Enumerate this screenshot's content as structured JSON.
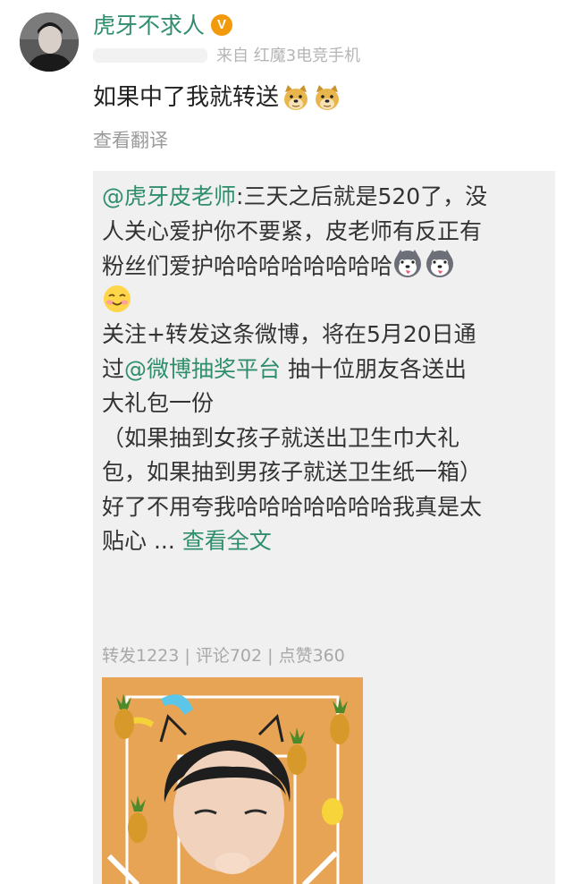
{
  "user": {
    "name": "虎牙不求人",
    "verified_icon": "verified-v-icon",
    "verified_color": "#f29a0c",
    "source": "来自 红魔3电竞手机"
  },
  "post": {
    "text": "如果中了我就转送",
    "emoji_icon": "doge-emoji-icon",
    "translate_label": "查看翻译"
  },
  "repost": {
    "author_mention": "@虎牙皮老师",
    "colon": ":",
    "line1_rest": "三天之后就是520了，没",
    "line2": "人关心爱护你不要紧，皮老师有反正有",
    "line3": "粉丝们爱护哈哈哈哈哈哈哈哈",
    "line5": "关注+转发这条微博，将在5月20日通",
    "line6_pre": "过",
    "lottery_mention": "@微博抽奖平台",
    "line6_post": " 抽十位朋友各送出",
    "line7": "大礼包一份",
    "line8": "（如果抽到女孩子就送出卫生巾大礼",
    "line9": "包，如果抽到男孩子就送卫生纸一箱）",
    "line10": "好了不用夸我哈哈哈哈哈哈哈我真是太",
    "line11_pre": "贴心 ... ",
    "read_more": "查看全文",
    "stats": "转发1223 | 评论702 | 点赞360",
    "emojis": [
      "husky-emoji-icon",
      "husky-emoji-icon",
      "smile-emoji-icon"
    ]
  },
  "colors": {
    "link": "#2f8e6b",
    "repost_bg": "#f0f0f0",
    "thumbnail_bg": "#e8a455"
  }
}
